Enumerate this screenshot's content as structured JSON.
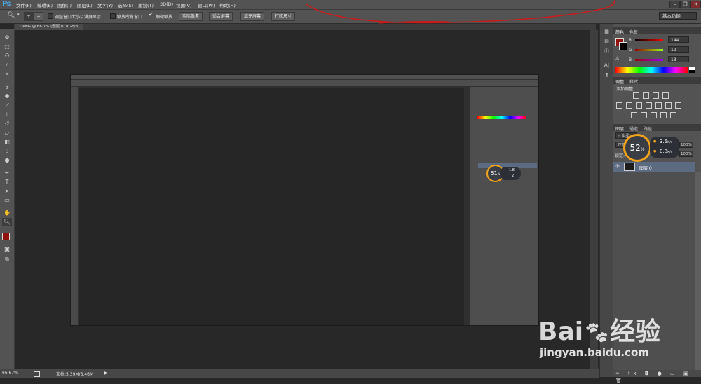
{
  "app": {
    "logo": "Ps"
  },
  "menu": {
    "items": [
      "文件(F)",
      "编辑(E)",
      "图像(I)",
      "图层(L)",
      "文字(Y)",
      "选择(S)",
      "滤镜(T)",
      "3D(D)",
      "视图(V)",
      "窗口(W)",
      "帮助(H)"
    ]
  },
  "options": {
    "resize_windows_label": "调整窗口大小以满屏显示",
    "zoom_all_label": "缩放所有窗口",
    "scrubby_zoom_label": "细微缩放",
    "actual_pixels_button": "实际像素",
    "fit_screen_button": "适合屏幕",
    "fill_screen_button": "填充屏幕",
    "print_size_button": "打印尺寸",
    "workspace": "基本功能"
  },
  "document": {
    "tab_title": "1.PNG @ 66.7% (图层 0, RGB/8)"
  },
  "status": {
    "zoom": "66.67%",
    "doc_info": "文档:5.39M/3.46M",
    "arrow": "▶"
  },
  "color_panel": {
    "tabs": [
      "颜色",
      "色板"
    ],
    "r_label": "R",
    "g_label": "G",
    "b_label": "B",
    "r_value": "144",
    "g_value": "19",
    "b_value": "13",
    "fg_color": "#90130d"
  },
  "adjust_panel": {
    "tabs": [
      "调整",
      "样式"
    ],
    "title": "添加调整"
  },
  "layers_panel": {
    "tabs": [
      "图层",
      "通道",
      "路径"
    ],
    "filter_label": "ρ 类型",
    "blend_mode": "正常",
    "lock_label": "锁定:",
    "opacity_value": "100%",
    "fill_value": "100%",
    "layer_name": "图层 0"
  },
  "net_speed": {
    "percent": "52",
    "unit": "%",
    "up": "3.5",
    "down": "0.8",
    "speed_unit": "K/s"
  },
  "inner_net_speed": {
    "percent": "51",
    "unit": "%",
    "up": "1.8",
    "down": "2"
  },
  "watermark": {
    "brand": "Bai",
    "brand2": "经验",
    "url": "jingyan.baidu.com"
  },
  "colors": {
    "accent": "#f3a21a",
    "selected_layer": "#5d6b82",
    "annotation": "#cc1a1a"
  }
}
